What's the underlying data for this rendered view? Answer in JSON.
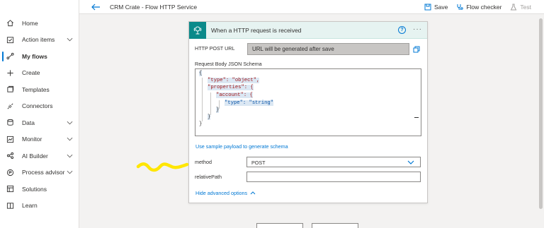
{
  "sidebar": {
    "items": [
      {
        "label": "Home",
        "icon": "home-icon",
        "chevron": false
      },
      {
        "label": "Action items",
        "icon": "action-items-icon",
        "chevron": true
      },
      {
        "label": "My flows",
        "icon": "flows-icon",
        "chevron": false,
        "active": true
      },
      {
        "label": "Create",
        "icon": "plus-icon",
        "chevron": false
      },
      {
        "label": "Templates",
        "icon": "templates-icon",
        "chevron": false
      },
      {
        "label": "Connectors",
        "icon": "connectors-icon",
        "chevron": false
      },
      {
        "label": "Data",
        "icon": "data-icon",
        "chevron": true
      },
      {
        "label": "Monitor",
        "icon": "monitor-icon",
        "chevron": true
      },
      {
        "label": "AI Builder",
        "icon": "ai-builder-icon",
        "chevron": true
      },
      {
        "label": "Process advisor",
        "icon": "process-advisor-icon",
        "chevron": true
      },
      {
        "label": "Solutions",
        "icon": "solutions-icon",
        "chevron": false
      },
      {
        "label": "Learn",
        "icon": "learn-icon",
        "chevron": false
      }
    ]
  },
  "header": {
    "title": "CRM Crate - Flow HTTP Service",
    "save_label": "Save",
    "flow_checker_label": "Flow checker",
    "test_label": "Test"
  },
  "card": {
    "title": "When a HTTP request is received",
    "help_glyph": "?",
    "more_glyph": "···",
    "post_url_label": "HTTP POST URL",
    "post_url_value": "URL will be generated after save",
    "schema_label": "Request Body JSON Schema",
    "schema_lines": [
      "{",
      "\"type\": \"object\",",
      "\"properties\": {",
      "\"account\": {",
      "\"type\": \"string\"",
      "}",
      "}",
      "}"
    ],
    "sample_payload_link": "Use sample payload to generate schema",
    "method_label": "method",
    "method_value": "POST",
    "relative_path_label": "relativePath",
    "relative_path_value": "",
    "hide_advanced_label": "Hide advanced options"
  },
  "colors": {
    "accent": "#0078d4",
    "trigger_teal": "#0a8a8a",
    "header_bg": "#e6f3f1",
    "annotation_yellow": "#ffe600"
  }
}
